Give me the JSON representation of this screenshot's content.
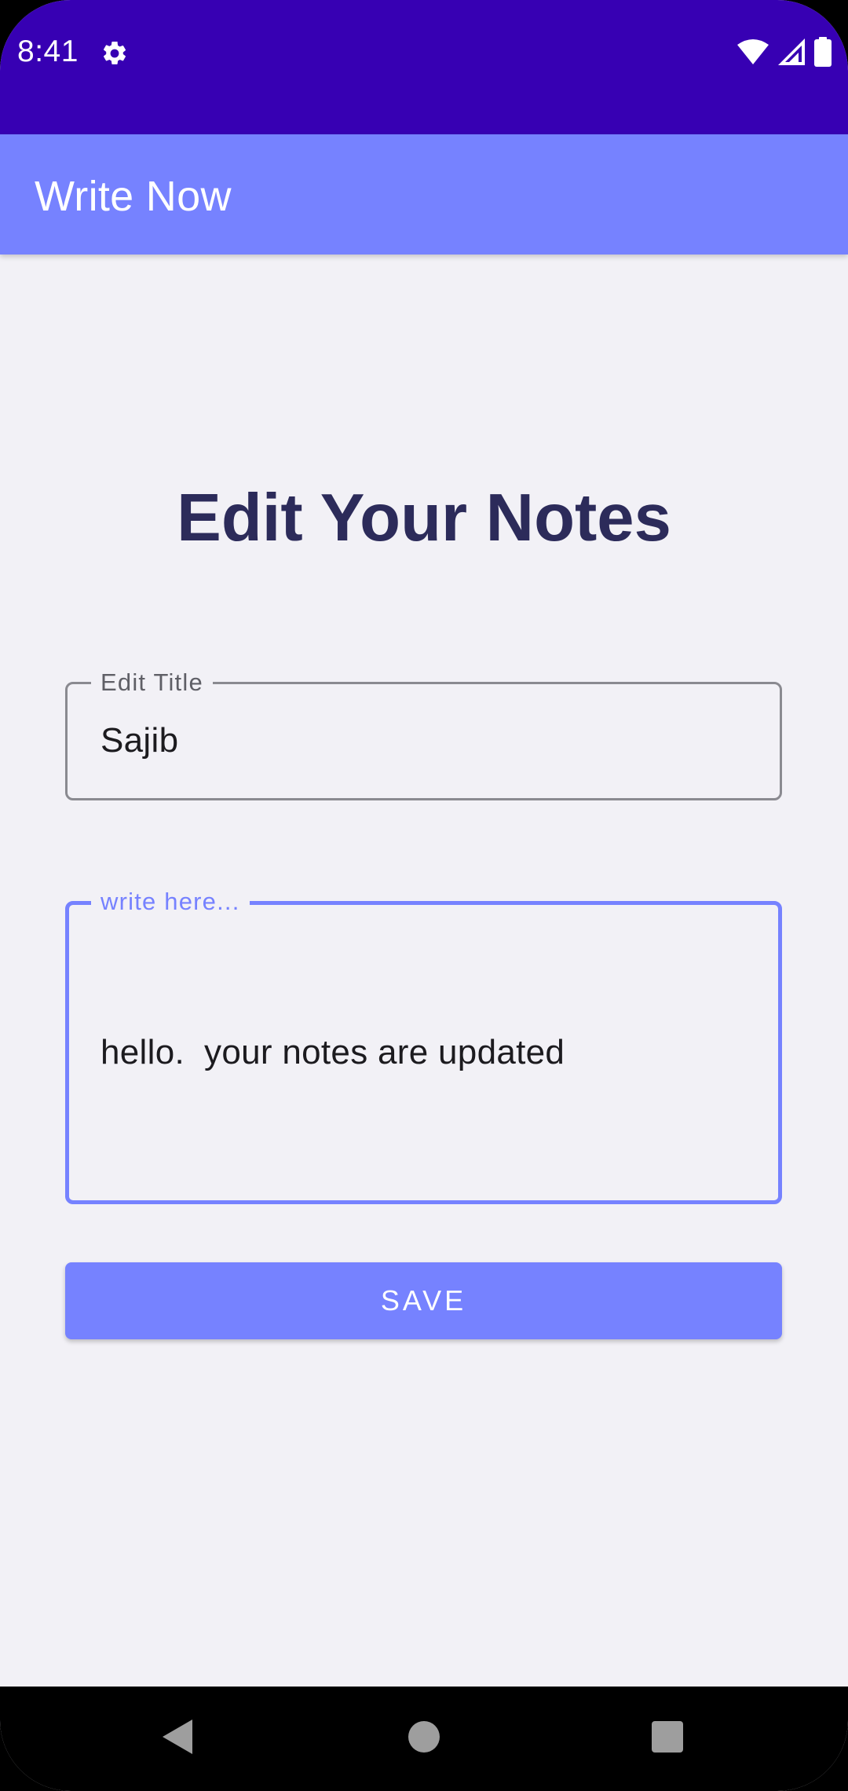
{
  "status_bar": {
    "time": "8:41",
    "icons": [
      "gear-icon",
      "wifi-icon",
      "signal-icon",
      "battery-icon"
    ]
  },
  "app_bar": {
    "title": "Write Now"
  },
  "main": {
    "heading": "Edit Your Notes",
    "title_field": {
      "label": "Edit Title",
      "value": "Sajib"
    },
    "body_field": {
      "label": "write here...",
      "value": "hello.  your notes are updated"
    },
    "save_label": "SAVE"
  },
  "nav_bar": {
    "icons": [
      "back-icon",
      "home-icon",
      "recents-icon"
    ]
  },
  "colors": {
    "status_bar": "#3700b3",
    "app_bar": "#7682ff",
    "accent": "#7682ff",
    "background": "#f2f1f6",
    "heading": "#2c2b5a"
  }
}
